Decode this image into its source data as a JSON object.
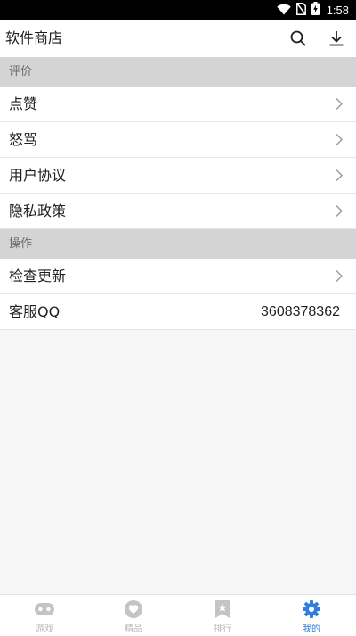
{
  "status_bar": {
    "time": "1:58",
    "icons": [
      "wifi-icon",
      "no-sim-icon",
      "battery-charging-icon"
    ]
  },
  "app_bar": {
    "title": "软件商店",
    "actions": [
      "search-icon",
      "download-icon"
    ]
  },
  "sections": [
    {
      "header": "评价",
      "items": [
        {
          "label": "点赞"
        },
        {
          "label": "怒骂"
        },
        {
          "label": "用户协议"
        },
        {
          "label": "隐私政策"
        }
      ]
    },
    {
      "header": "操作",
      "items": [
        {
          "label": "检查更新"
        },
        {
          "label": "客服QQ",
          "value": "3608378362"
        }
      ]
    }
  ],
  "bottom_nav": {
    "items": [
      {
        "label": "游戏",
        "icon": "gamepad-icon"
      },
      {
        "label": "精品",
        "icon": "heart-icon"
      },
      {
        "label": "排行",
        "icon": "ranking-bookmark-icon"
      },
      {
        "label": "我的",
        "icon": "gear-icon",
        "active": true
      }
    ]
  },
  "colors": {
    "accent": "#2f7fdb",
    "nav_inactive": "#b8b8b8",
    "section_header_bg": "#d4d4d4",
    "page_bg": "#f6f6f6",
    "status_bar_bg": "#000000"
  }
}
